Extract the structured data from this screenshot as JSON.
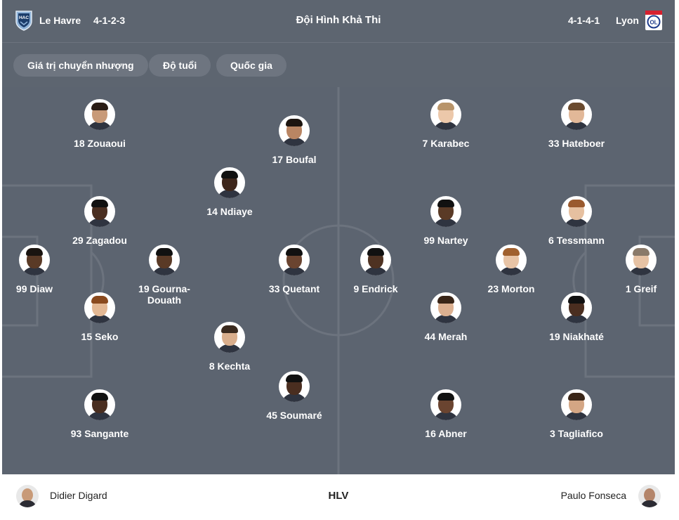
{
  "header": {
    "home_team": "Le Havre",
    "home_formation": "4-1-2-3",
    "title": "Đội Hình Khả Thi",
    "away_formation": "4-1-4-1",
    "away_team": "Lyon",
    "home_logo_text": "HAC",
    "away_logo_text": "OL"
  },
  "tabs": [
    {
      "label": "Giá trị chuyển nhượng"
    },
    {
      "label": "Độ tuổi"
    },
    {
      "label": "Quốc gia"
    }
  ],
  "home_players": [
    {
      "label": "99 Diaw",
      "skin": "#5a3a26",
      "hair": "#1a1410"
    },
    {
      "label": "29 Zagadou",
      "skin": "#4a2e20",
      "hair": "#111"
    },
    {
      "label": "15 Seko",
      "skin": "#e3b894",
      "hair": "#8a4a1e"
    },
    {
      "label": "18 Zouaoui",
      "skin": "#c89a78",
      "hair": "#2a1c14"
    },
    {
      "label": "93 Sangante",
      "skin": "#4a2e20",
      "hair": "#111"
    },
    {
      "label": "19 Gourna-\nDouath",
      "skin": "#5a3a26",
      "hair": "#111"
    },
    {
      "label": "14 Ndiaye",
      "skin": "#3e271b",
      "hair": "#111"
    },
    {
      "label": "8 Kechta",
      "skin": "#d9ae8c",
      "hair": "#3a2a1e"
    },
    {
      "label": "17 Boufal",
      "skin": "#b98563",
      "hair": "#1d1510"
    },
    {
      "label": "33 Quetant",
      "skin": "#6a4430",
      "hair": "#111"
    },
    {
      "label": "45 Soumaré",
      "skin": "#4a2e20",
      "hair": "#111"
    }
  ],
  "away_players": [
    {
      "label": "1 Greif",
      "skin": "#e6c2a4",
      "hair": "#8a7a6a"
    },
    {
      "label": "33 Hateboer",
      "skin": "#e2b898",
      "hair": "#6a4a2e"
    },
    {
      "label": "6 Tessmann",
      "skin": "#e6c0a0",
      "hair": "#9a5a2e"
    },
    {
      "label": "19 Niakhaté",
      "skin": "#4a2e20",
      "hair": "#111"
    },
    {
      "label": "3 Tagliafico",
      "skin": "#d4a684",
      "hair": "#3a2618"
    },
    {
      "label": "23 Morton",
      "skin": "#e8c4a6",
      "hair": "#a0602e"
    },
    {
      "label": "7 Karabec",
      "skin": "#ecc8aa",
      "hair": "#b8946a"
    },
    {
      "label": "99 Nartey",
      "skin": "#5a3a26",
      "hair": "#111"
    },
    {
      "label": "44 Merah",
      "skin": "#dcb090",
      "hair": "#3a2618"
    },
    {
      "label": "16 Abner",
      "skin": "#6a4430",
      "hair": "#111"
    },
    {
      "label": "9 Endrick",
      "skin": "#4e3222",
      "hair": "#111"
    }
  ],
  "footer": {
    "home_coach": "Didier Digard",
    "center_label": "HLV",
    "away_coach": "Paulo Fonseca"
  },
  "colors": {
    "header_bg": "#5d6570",
    "pitch_bg": "#5c6470",
    "pitch_lines": "#6c737e",
    "tab_bg": "#6e7580"
  }
}
